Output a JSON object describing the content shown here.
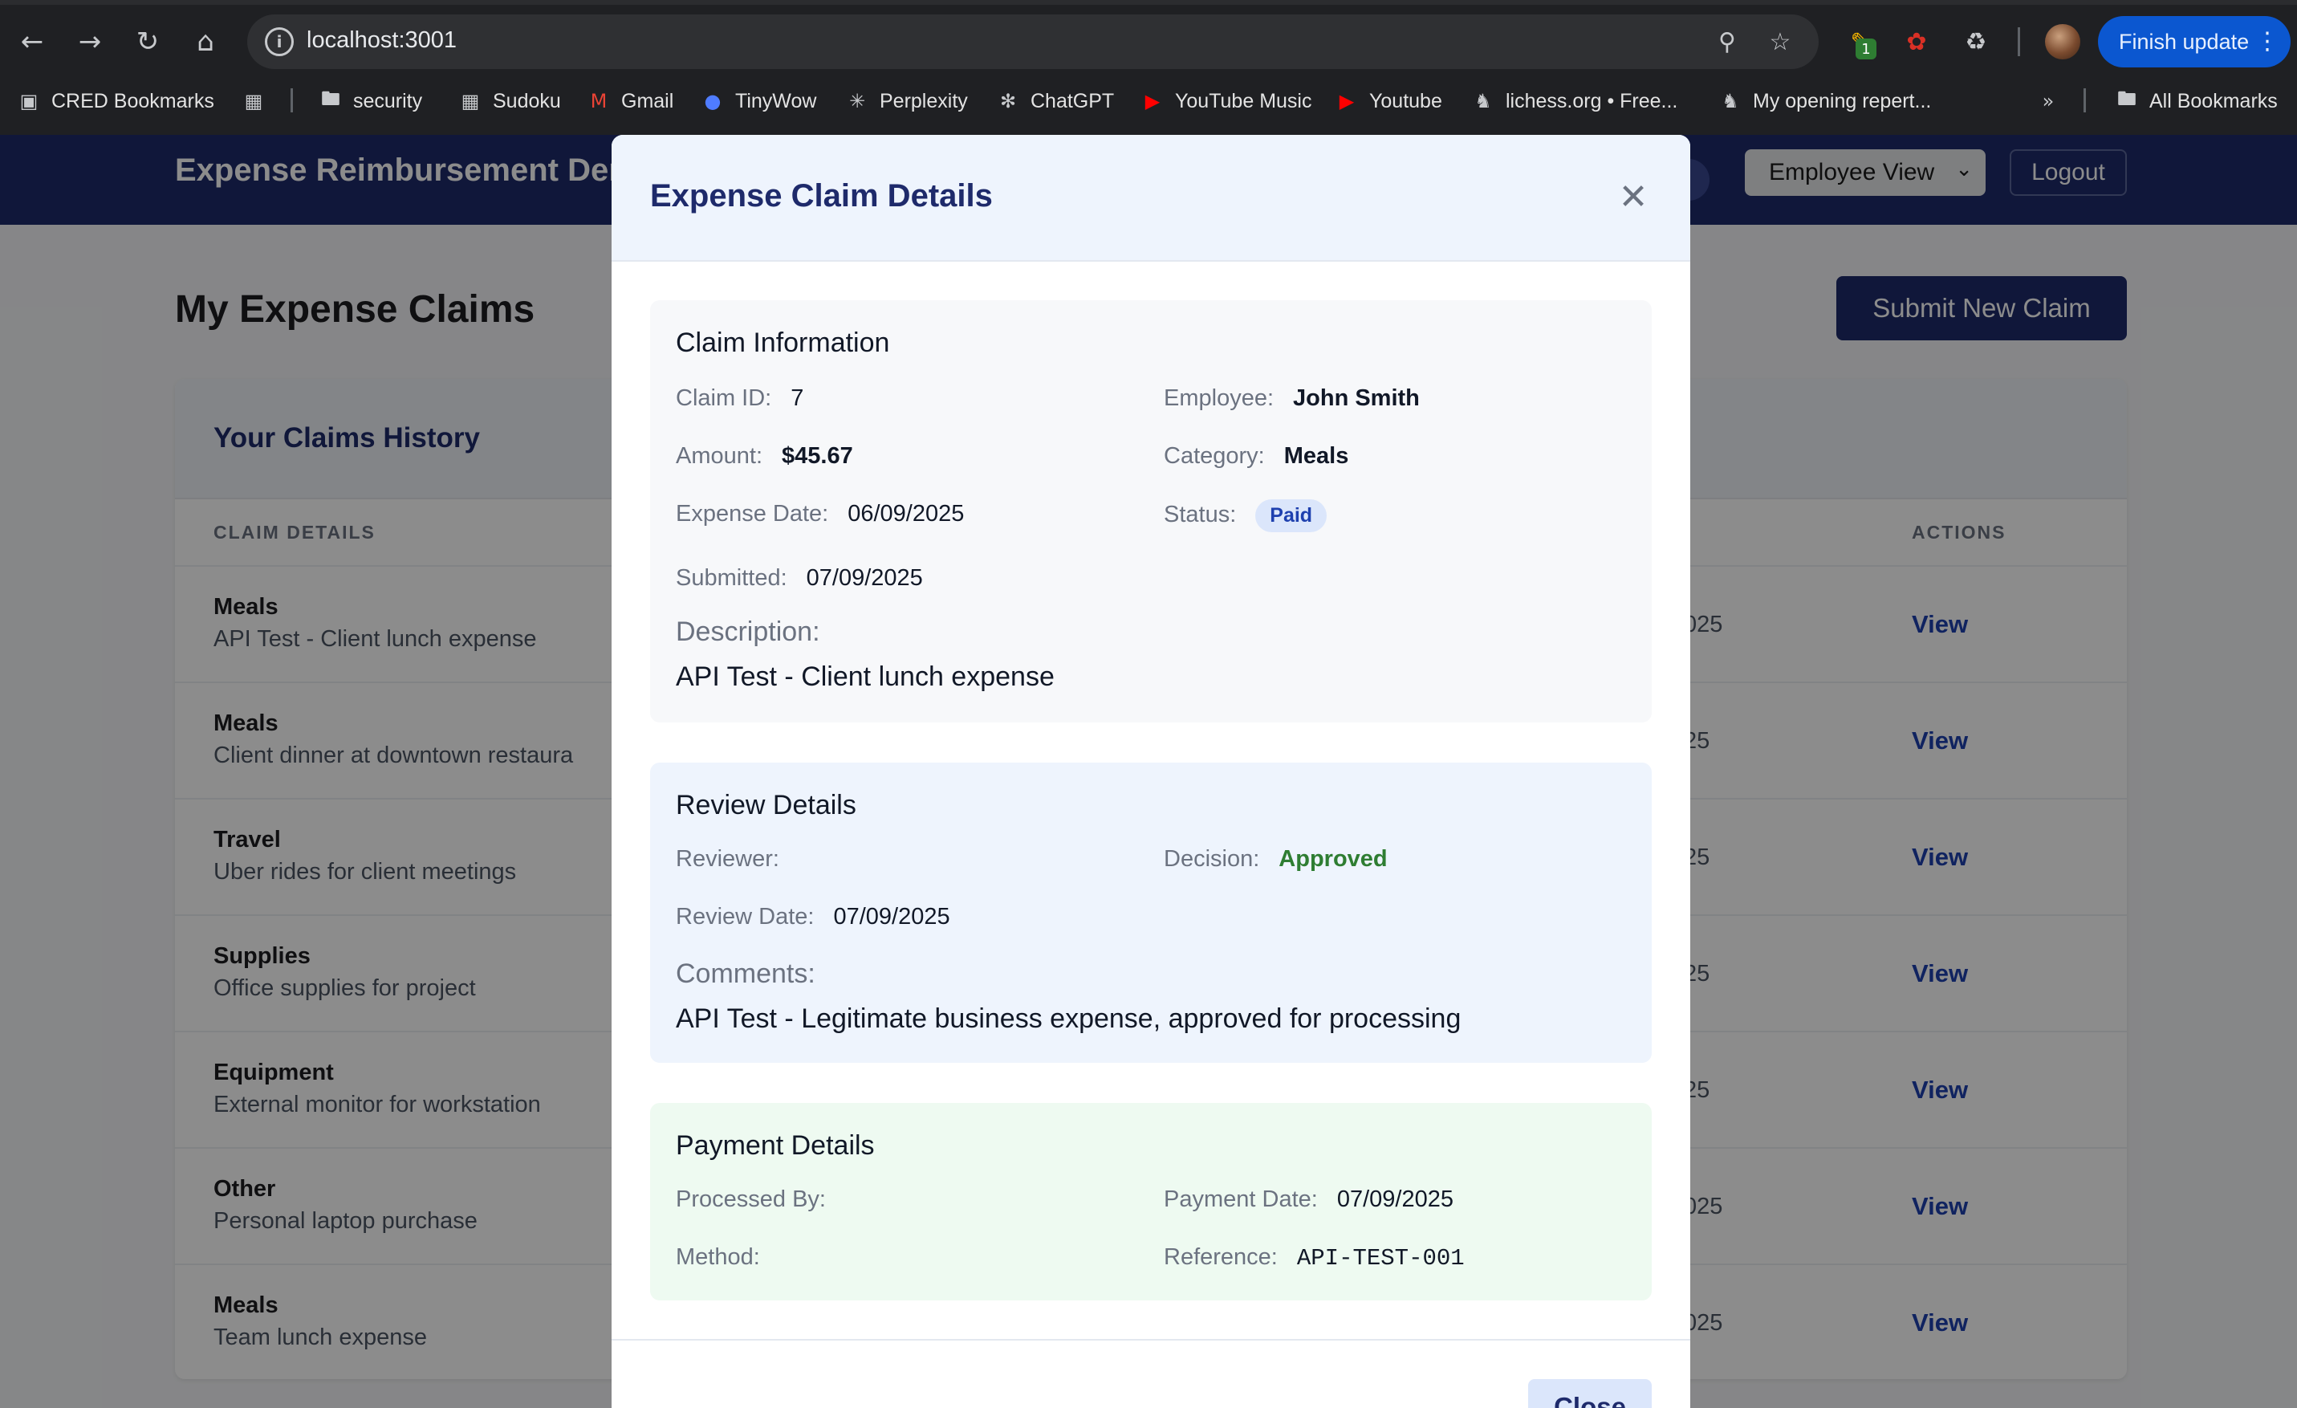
{
  "browser": {
    "url": "localhost:3001",
    "finish_update": "Finish update",
    "extension_badge": "1",
    "bookmarks": [
      {
        "label": "CRED Bookmarks",
        "icon": "bookmark-manager-icon"
      },
      {
        "label": "security",
        "icon": "folder-icon"
      },
      {
        "label": "Sudoku",
        "icon": "grid-icon"
      },
      {
        "label": "Gmail",
        "icon": "gmail-icon"
      },
      {
        "label": "TinyWow",
        "icon": "tinywow-icon"
      },
      {
        "label": "Perplexity",
        "icon": "perplexity-icon"
      },
      {
        "label": "ChatGPT",
        "icon": "chatgpt-icon"
      },
      {
        "label": "YouTube Music",
        "icon": "youtube-music-icon"
      },
      {
        "label": "Youtube",
        "icon": "youtube-icon"
      },
      {
        "label": "lichess.org • Free...",
        "icon": "lichess-icon"
      },
      {
        "label": "My opening repert...",
        "icon": "lichess-icon"
      }
    ],
    "all_bookmarks": "All Bookmarks"
  },
  "app": {
    "title": "Expense Reimbursement Dem",
    "view_select": "Employee View",
    "logout": "Logout",
    "page_title": "My Expense Claims",
    "submit_button": "Submit New Claim",
    "history_title": "Your Claims History",
    "columns": {
      "details": "CLAIM DETAILS",
      "actions": "ACTIONS"
    },
    "rows": [
      {
        "category": "Meals",
        "description": "API Test - Client lunch expense",
        "date": "025",
        "action": "View"
      },
      {
        "category": "Meals",
        "description": "Client dinner at downtown restaura",
        "date": "25",
        "action": "View"
      },
      {
        "category": "Travel",
        "description": "Uber rides for client meetings",
        "date": "25",
        "action": "View"
      },
      {
        "category": "Supplies",
        "description": "Office supplies for project",
        "date": "25",
        "action": "View"
      },
      {
        "category": "Equipment",
        "description": "External monitor for workstation",
        "date": "25",
        "action": "View"
      },
      {
        "category": "Other",
        "description": "Personal laptop purchase",
        "date": "025",
        "action": "View"
      },
      {
        "category": "Meals",
        "description": "Team lunch expense",
        "date": "025",
        "action": "View"
      }
    ]
  },
  "modal": {
    "title": "Expense Claim Details",
    "claim": {
      "section_title": "Claim Information",
      "claim_id_label": "Claim ID:",
      "claim_id": "7",
      "employee_label": "Employee:",
      "employee": "John Smith",
      "amount_label": "Amount:",
      "amount": "$45.67",
      "category_label": "Category:",
      "category": "Meals",
      "expense_date_label": "Expense Date:",
      "expense_date": "06/09/2025",
      "status_label": "Status:",
      "status": "Paid",
      "submitted_label": "Submitted:",
      "submitted": "07/09/2025",
      "description_label": "Description:",
      "description": "API Test - Client lunch expense"
    },
    "review": {
      "section_title": "Review Details",
      "reviewer_label": "Reviewer:",
      "reviewer": "",
      "decision_label": "Decision:",
      "decision": "Approved",
      "review_date_label": "Review Date:",
      "review_date": "07/09/2025",
      "comments_label": "Comments:",
      "comments": "API Test - Legitimate business expense, approved for processing"
    },
    "payment": {
      "section_title": "Payment Details",
      "processed_by_label": "Processed By:",
      "processed_by": "",
      "payment_date_label": "Payment Date:",
      "payment_date": "07/09/2025",
      "method_label": "Method:",
      "method": "",
      "reference_label": "Reference:",
      "reference": "API-TEST-001"
    },
    "footer_close": "Close"
  },
  "colors": {
    "header_navy": "#1e2a6b",
    "link_blue": "#1e40af",
    "approved_green": "#2e7d32",
    "finish_update_blue": "#0b57d0"
  }
}
